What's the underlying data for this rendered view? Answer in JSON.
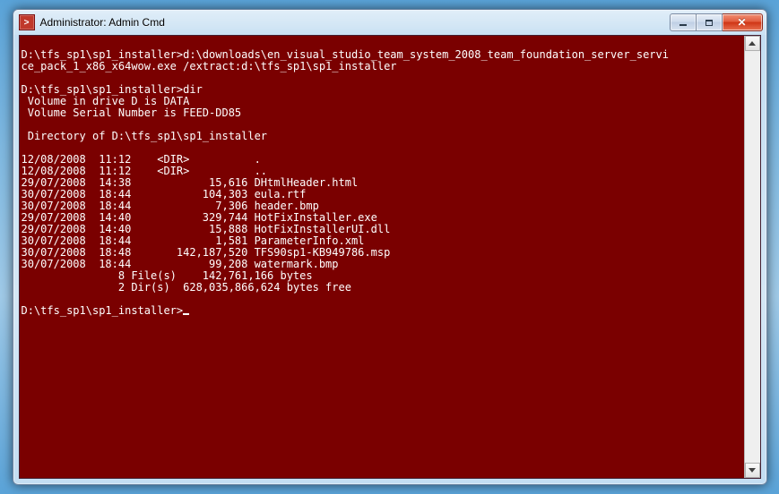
{
  "window": {
    "title": "Administrator: Admin Cmd",
    "icon_glyph": ">"
  },
  "terminal": {
    "lines": [
      "",
      "D:\\tfs_sp1\\sp1_installer>d:\\downloads\\en_visual_studio_team_system_2008_team_foundation_server_servi",
      "ce_pack_1_x86_x64wow.exe /extract:d:\\tfs_sp1\\sp1_installer",
      "",
      "D:\\tfs_sp1\\sp1_installer>dir",
      " Volume in drive D is DATA",
      " Volume Serial Number is FEED-DD85",
      "",
      " Directory of D:\\tfs_sp1\\sp1_installer",
      "",
      "12/08/2008  11:12    <DIR>          .",
      "12/08/2008  11:12    <DIR>          ..",
      "29/07/2008  14:38            15,616 DHtmlHeader.html",
      "30/07/2008  18:44           104,303 eula.rtf",
      "30/07/2008  18:44             7,306 header.bmp",
      "29/07/2008  14:40           329,744 HotFixInstaller.exe",
      "29/07/2008  14:40            15,888 HotFixInstallerUI.dll",
      "30/07/2008  18:44             1,581 ParameterInfo.xml",
      "30/07/2008  18:48       142,187,520 TFS90sp1-KB949786.msp",
      "30/07/2008  18:44            99,208 watermark.bmp",
      "               8 File(s)    142,761,166 bytes",
      "               2 Dir(s)  628,035,866,624 bytes free",
      "",
      "D:\\tfs_sp1\\sp1_installer>"
    ]
  }
}
